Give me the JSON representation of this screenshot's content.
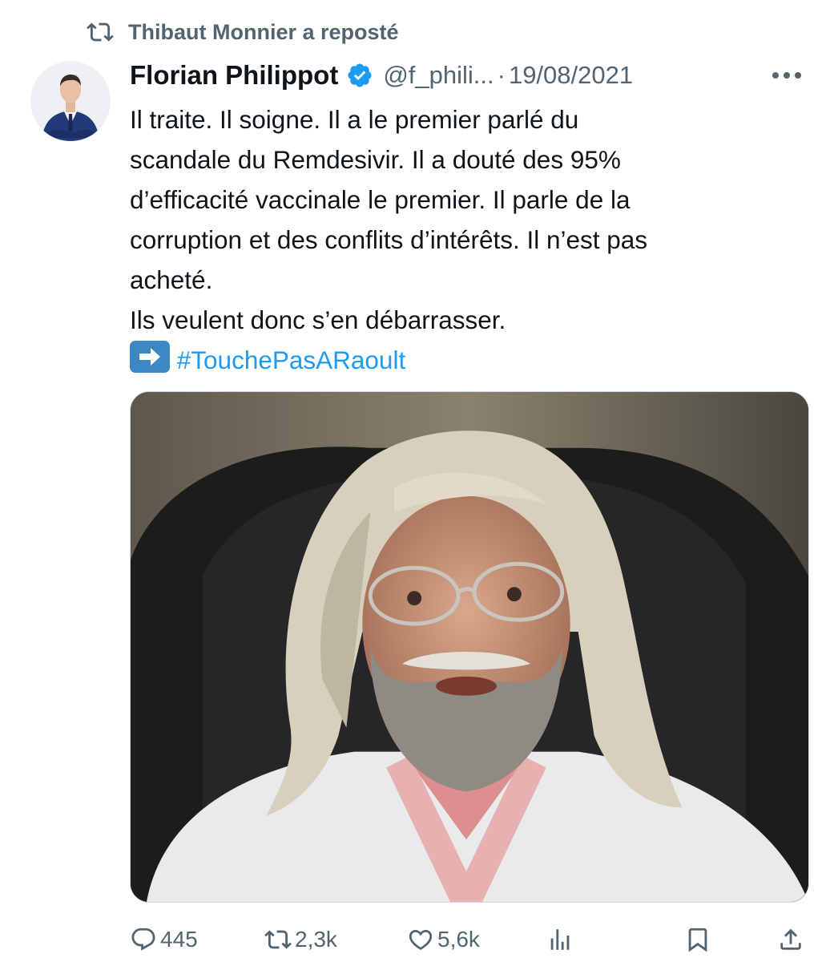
{
  "repost": {
    "text": "Thibaut Monnier a reposté",
    "icon": "repost-icon"
  },
  "author": {
    "display_name": "Florian Philippot",
    "handle": "@f_phili...",
    "separator": "·",
    "date": "19/08/2021",
    "verified_color": "#1d9bf0"
  },
  "body": {
    "lines": [
      "Il traite. Il soigne. Il a le premier parlé du",
      "scandale du Remdesivir. Il a douté des 95%",
      "d’efficacité vaccinale le premier. Il parle de la",
      "corruption et des conflits d’intérêts. Il n’est pas",
      "acheté.",
      "Ils veulent donc s’en débarrasser."
    ],
    "hashtag_emoji": "right-arrow-emoji",
    "hashtag": "#TouchePasARaoult"
  },
  "actions": {
    "replies": "445",
    "reposts": "2,3k",
    "likes": "5,6k"
  },
  "colors": {
    "text": "#0f1419",
    "muted": "#536471",
    "accent": "#1d9bf0"
  }
}
